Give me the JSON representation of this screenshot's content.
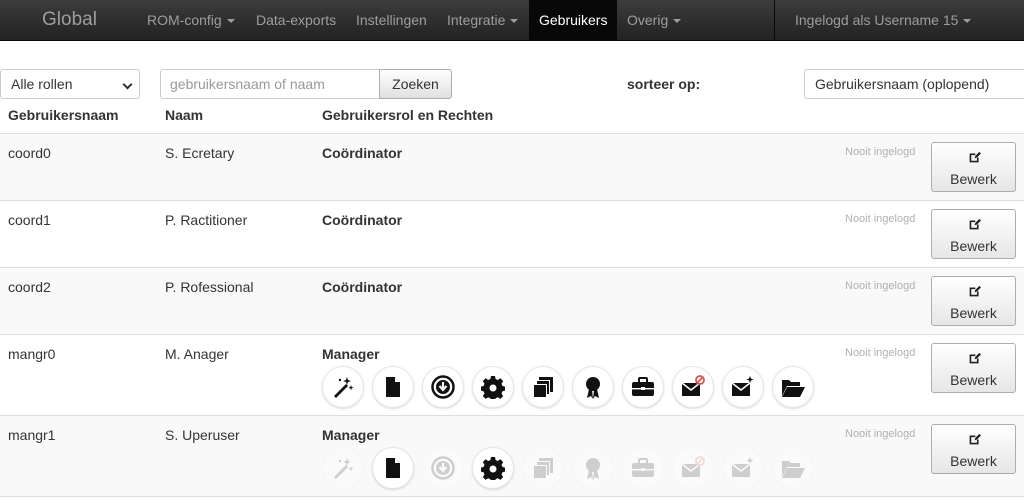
{
  "nav": {
    "brand": "Global",
    "items": [
      {
        "label": "ROM-config",
        "dropdown": true
      },
      {
        "label": "Data-exports",
        "dropdown": false
      },
      {
        "label": "Instellingen",
        "dropdown": false
      },
      {
        "label": "Integratie",
        "dropdown": true
      },
      {
        "label": "Gebruikers",
        "dropdown": false,
        "active": true
      },
      {
        "label": "Overig",
        "dropdown": true
      }
    ],
    "user_menu": "Ingelogd als Username 15"
  },
  "filters": {
    "role_select": "Alle rollen",
    "search_placeholder": "gebruikersnaam of naam",
    "search_button": "Zoeken",
    "sort_label": "sorteer op:",
    "sort_select": "Gebruikersnaam (oplopend)"
  },
  "table": {
    "headers": {
      "username": "Gebruikersnaam",
      "name": "Naam",
      "role": "Gebruikersrol en Rechten"
    },
    "edit_label": "Bewerk",
    "last_login": "Nooit ingelogd",
    "rows": [
      {
        "username": "coord0",
        "name": "S. Ecretary",
        "role": "Coördinator"
      },
      {
        "username": "coord1",
        "name": "P. Ractitioner",
        "role": "Coördinator"
      },
      {
        "username": "coord2",
        "name": "P. Rofessional",
        "role": "Coördinator"
      },
      {
        "username": "mangr0",
        "name": "M. Anager",
        "role": "Manager",
        "permissions": [
          {
            "icon": "magic-wand-icon",
            "enabled": true
          },
          {
            "icon": "document-icon",
            "enabled": true
          },
          {
            "icon": "download-icon",
            "enabled": true
          },
          {
            "icon": "gear-icon",
            "enabled": true
          },
          {
            "icon": "copy-icon",
            "enabled": true
          },
          {
            "icon": "award-icon",
            "enabled": true
          },
          {
            "icon": "briefcase-icon",
            "enabled": true
          },
          {
            "icon": "mail-blocked-icon",
            "enabled": true
          },
          {
            "icon": "mail-star-icon",
            "enabled": true
          },
          {
            "icon": "folder-open-icon",
            "enabled": true
          }
        ]
      },
      {
        "username": "mangr1",
        "name": "S. Uperuser",
        "role": "Manager",
        "permissions": [
          {
            "icon": "magic-wand-icon",
            "enabled": false
          },
          {
            "icon": "document-icon",
            "enabled": true
          },
          {
            "icon": "download-icon",
            "enabled": false
          },
          {
            "icon": "gear-icon",
            "enabled": true
          },
          {
            "icon": "copy-icon",
            "enabled": false
          },
          {
            "icon": "award-icon",
            "enabled": false
          },
          {
            "icon": "briefcase-icon",
            "enabled": false
          },
          {
            "icon": "mail-blocked-icon",
            "enabled": false
          },
          {
            "icon": "mail-star-icon",
            "enabled": false
          },
          {
            "icon": "folder-open-icon",
            "enabled": false
          }
        ]
      }
    ]
  }
}
